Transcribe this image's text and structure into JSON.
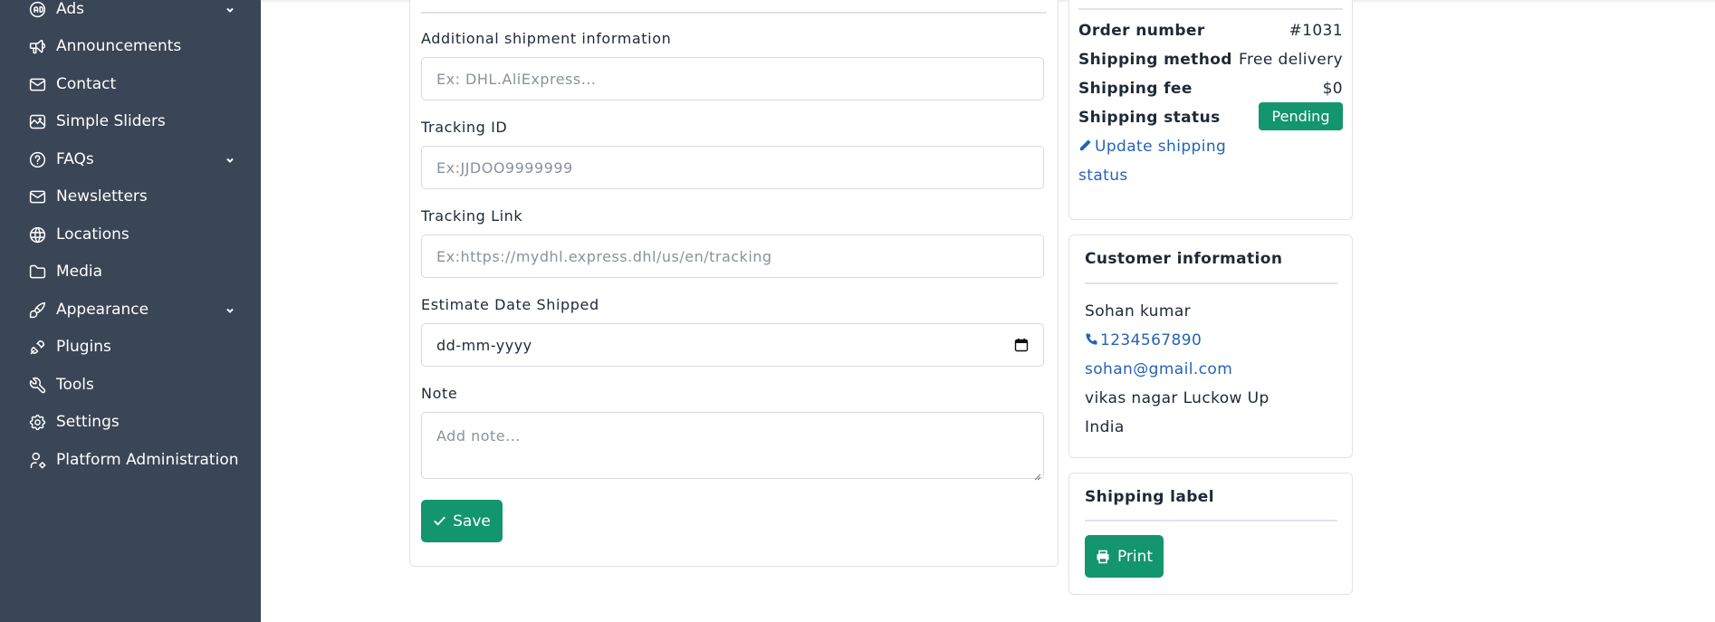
{
  "sidebar": {
    "items": [
      {
        "label": "Ads",
        "icon": "ad-icon",
        "has_chevron": true
      },
      {
        "label": "Announcements",
        "icon": "megaphone-icon",
        "has_chevron": false
      },
      {
        "label": "Contact",
        "icon": "mail-icon",
        "has_chevron": false
      },
      {
        "label": "Simple Sliders",
        "icon": "slides-icon",
        "has_chevron": false
      },
      {
        "label": "FAQs",
        "icon": "help-circle-icon",
        "has_chevron": true
      },
      {
        "label": "Newsletters",
        "icon": "mail-icon",
        "has_chevron": false
      },
      {
        "label": "Locations",
        "icon": "globe-icon",
        "has_chevron": false
      },
      {
        "label": "Media",
        "icon": "folder-icon",
        "has_chevron": false
      },
      {
        "label": "Appearance",
        "icon": "brush-icon",
        "has_chevron": true
      },
      {
        "label": "Plugins",
        "icon": "plug-icon",
        "has_chevron": false
      },
      {
        "label": "Tools",
        "icon": "wrench-icon",
        "has_chevron": false
      },
      {
        "label": "Settings",
        "icon": "gear-icon",
        "has_chevron": false
      },
      {
        "label": "Platform Administration",
        "icon": "user-cog-icon",
        "has_chevron": false
      }
    ],
    "background": "#3a4556"
  },
  "shipment_form": {
    "additional_info": {
      "label": "Additional shipment information",
      "placeholder": "Ex: DHL.AliExpress..."
    },
    "tracking_id": {
      "label": "Tracking ID",
      "placeholder": "Ex:JJDOO9999999"
    },
    "tracking_link": {
      "label": "Tracking Link",
      "placeholder": "Ex:https://mydhl.express.dhl/us/en/tracking"
    },
    "estimate_date": {
      "label": "Estimate Date Shipped",
      "value": "dd-mm-yyyy"
    },
    "note": {
      "label": "Note",
      "placeholder": "Add note..."
    },
    "save_label": "Save"
  },
  "order_summary": {
    "order_number_label": "Order number",
    "order_number_value": "#1031",
    "shipping_method_label": "Shipping method",
    "shipping_method_value": "Free delivery",
    "shipping_fee_label": "Shipping fee",
    "shipping_fee_value": "$0",
    "shipping_status_label": "Shipping status",
    "shipping_status_value": "Pending",
    "update_link_line1": "Update shipping",
    "update_link_line2": "status"
  },
  "customer": {
    "title": "Customer information",
    "name": "Sohan kumar",
    "phone": "1234567890",
    "email": "sohan@gmail.com",
    "address_line1": "vikas nagar Luckow Up",
    "address_line2": "India"
  },
  "shipping_label": {
    "title": "Shipping label",
    "print_label": "Print"
  },
  "colors": {
    "accent": "#13956e",
    "link": "#2563b6",
    "border": "#dfe3e8"
  }
}
